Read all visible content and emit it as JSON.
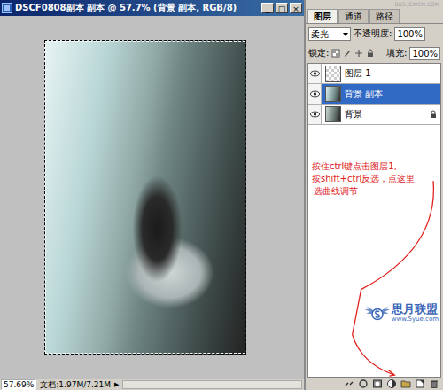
{
  "window": {
    "title": "DSCF0808副本 副本 @ 57.7% (背景 副本, RGB/8)",
    "buttons": [
      "_",
      "□",
      "×"
    ]
  },
  "status_bar": {
    "zoom": "57.69%",
    "doc": "文档:1.97M/7.21M",
    "arrow": "▶"
  },
  "panel": {
    "watermark": "BBS.JCWCN.COM",
    "tabs": [
      {
        "label": "图层",
        "selected": true
      },
      {
        "label": "通道",
        "selected": false
      },
      {
        "label": "路径",
        "selected": false
      }
    ],
    "blend_mode": "柔光",
    "opacity_label": "不透明度:",
    "opacity": "100%",
    "lock_label": "锁定:",
    "fill_label": "填充:",
    "fill": "100%"
  },
  "layers": [
    {
      "name": "图层 1",
      "visible": true,
      "selected": false,
      "locked": false
    },
    {
      "name": "背景 副本",
      "visible": true,
      "selected": true,
      "locked": false
    },
    {
      "name": "背景",
      "visible": true,
      "selected": false,
      "locked": true
    }
  ],
  "annotation": [
    "按住ctrl键点击图层1,",
    "按shift+ctrl反选，点这里",
    "选曲线调节"
  ],
  "logo": {
    "name": "思月联盟",
    "url": "www.5yue.com"
  }
}
